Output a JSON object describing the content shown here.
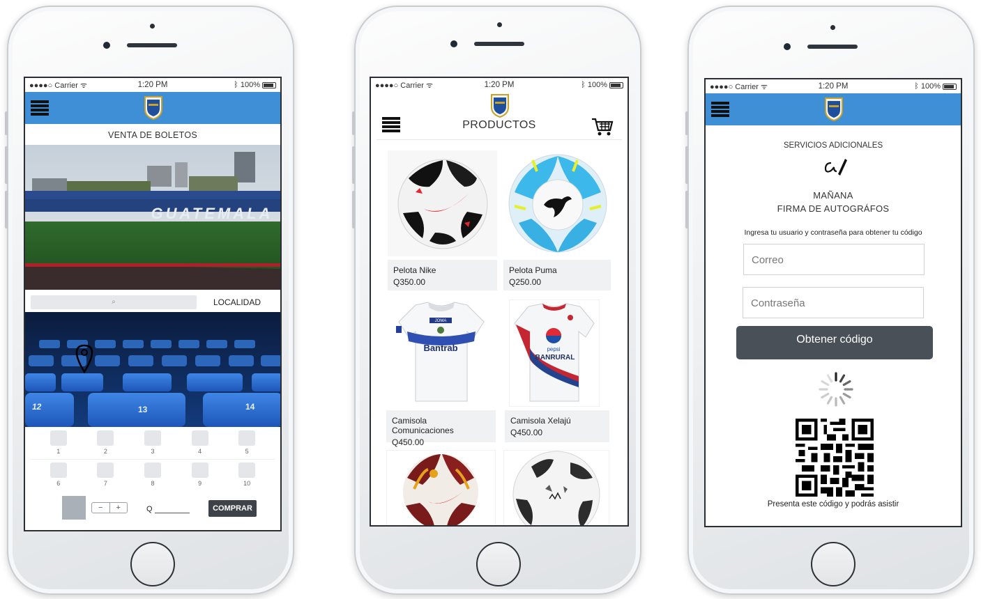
{
  "status": {
    "carrier": "Carrier",
    "time": "1:20 PM",
    "battery": "100%"
  },
  "tickets": {
    "title": "VENTA DE BOLETOS",
    "stadium_text": "GUATEMALA",
    "search_placeholder": "",
    "localidad": "LOCALIDAD",
    "seat_numbers": [
      "12",
      "13",
      "14"
    ],
    "seats": [
      "1",
      "2",
      "3",
      "4",
      "5",
      "6",
      "7",
      "8",
      "9",
      "10"
    ],
    "currency": "Q",
    "buy": "COMPRAR",
    "stepper_minus": "−",
    "stepper_plus": "+"
  },
  "products": {
    "title": "PRODUCTOS",
    "items": [
      {
        "name": "Pelota Nike",
        "price": "Q350.00"
      },
      {
        "name": "Pelota Puma",
        "price": "Q250.00"
      },
      {
        "name": "Camisola Comunicaciones",
        "price": "Q450.00"
      },
      {
        "name": "Camisola Xelajú",
        "price": "Q450.00"
      }
    ],
    "jersey1_sponsor": "Bantrab",
    "jersey1_brand": "JOMA",
    "jersey2_sponsor": "BANRURAL",
    "jersey2_brand": "pepsi"
  },
  "services": {
    "title": "SERVICIOS ADICIONALES",
    "event_day": "MAÑANA",
    "event_name": "FIRMA DE AUTOGRÁFOS",
    "instructions": "Ingresa tu usuario y contraseña para obtener tu código",
    "email_placeholder": "Correo",
    "password_placeholder": "Contraseña",
    "button": "Obtener código",
    "footer": "Presenta este código y podrás asistir"
  },
  "colors": {
    "header_blue": "#3e8fd6",
    "button_dark": "#4a5058",
    "buy_button": "#3e4349"
  }
}
